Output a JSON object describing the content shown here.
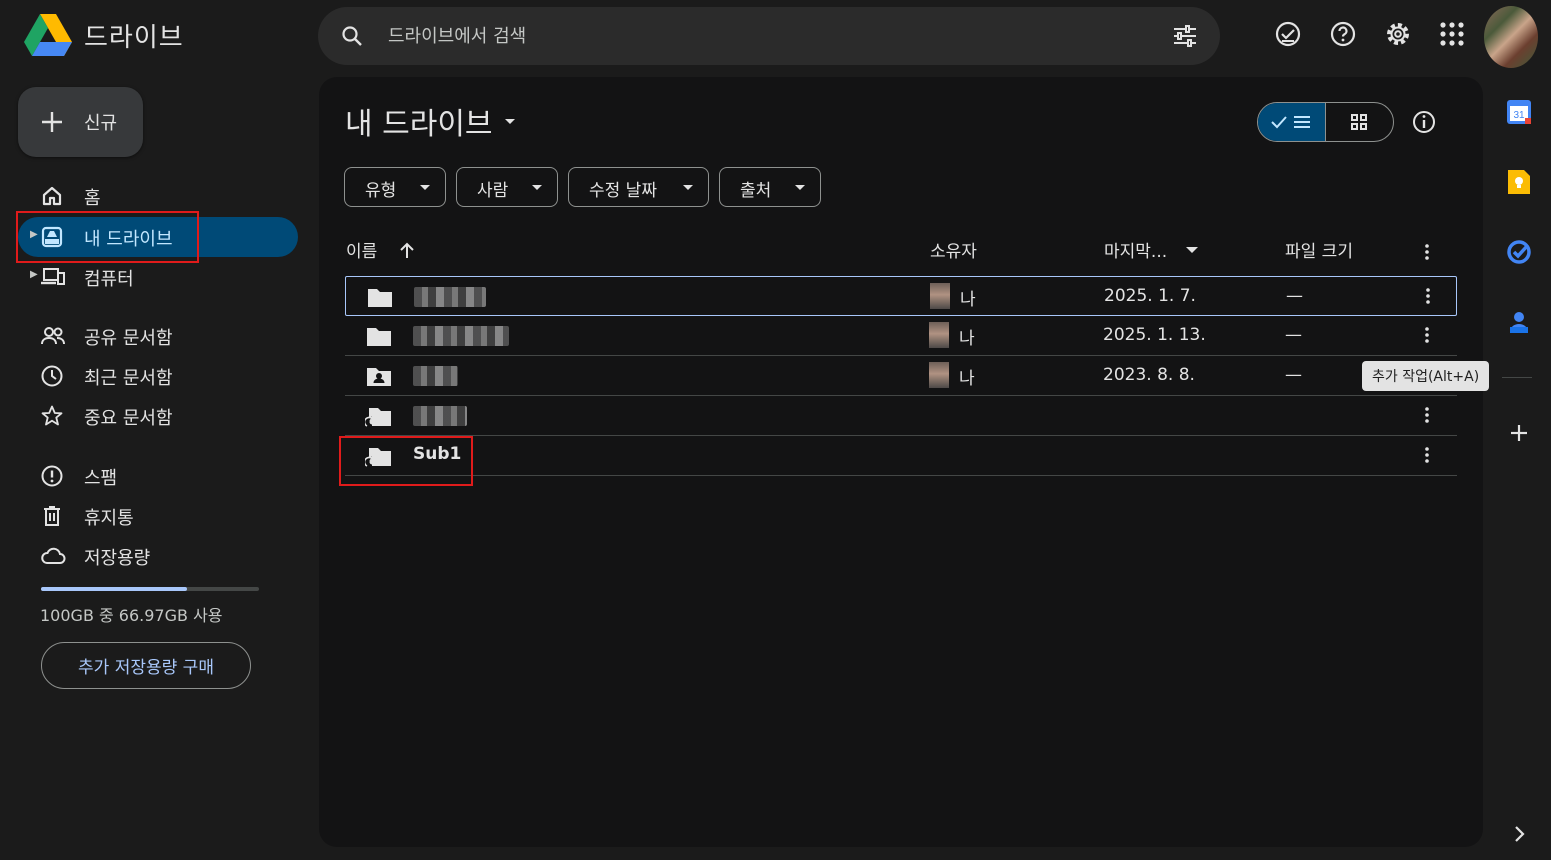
{
  "app": {
    "title": "드라이브"
  },
  "search": {
    "placeholder": "드라이브에서 검색"
  },
  "header_icons": [
    "ready-for-offline-icon",
    "help-icon",
    "settings-icon",
    "apps-grid-icon"
  ],
  "new_button": {
    "label": "신규"
  },
  "nav": {
    "home": "홈",
    "my_drive": "내 드라이브",
    "computers": "컴퓨터",
    "shared": "공유 문서함",
    "recent": "최근 문서함",
    "starred": "중요 문서함",
    "spam": "스팸",
    "trash": "휴지통",
    "storage": "저장용량"
  },
  "storage": {
    "used_fraction": 0.6697,
    "text": "100GB 중 66.97GB 사용",
    "buy_label": "추가 저장용량 구매"
  },
  "main": {
    "title": "내 드라이브",
    "chips": [
      "유형",
      "사람",
      "수정 날짜",
      "출처"
    ],
    "columns": {
      "name": "이름",
      "owner": "소유자",
      "modified": "마지막...",
      "size": "파일 크기"
    },
    "rows": [
      {
        "type": "folder",
        "name": "",
        "owner": "나",
        "date": "2025. 1. 7.",
        "size": "—"
      },
      {
        "type": "folder",
        "name": "",
        "owner": "나",
        "date": "2025. 1. 13.",
        "size": "—"
      },
      {
        "type": "shared-folder",
        "name": "",
        "owner": "나",
        "date": "2023. 8. 8.",
        "size": "—"
      },
      {
        "type": "shortcut-folder",
        "name": "",
        "owner": "",
        "date": "",
        "size": ""
      },
      {
        "type": "shortcut-folder",
        "name": "Sub1",
        "owner": "",
        "date": "",
        "size": ""
      }
    ],
    "tooltip": "추가 작업(Alt+A)"
  },
  "rail": {
    "calendar_day": "31"
  },
  "colors": {
    "accent": "#a8c7fa",
    "active_nav_bg": "#004a77",
    "highlight_box": "#e01b1b"
  }
}
